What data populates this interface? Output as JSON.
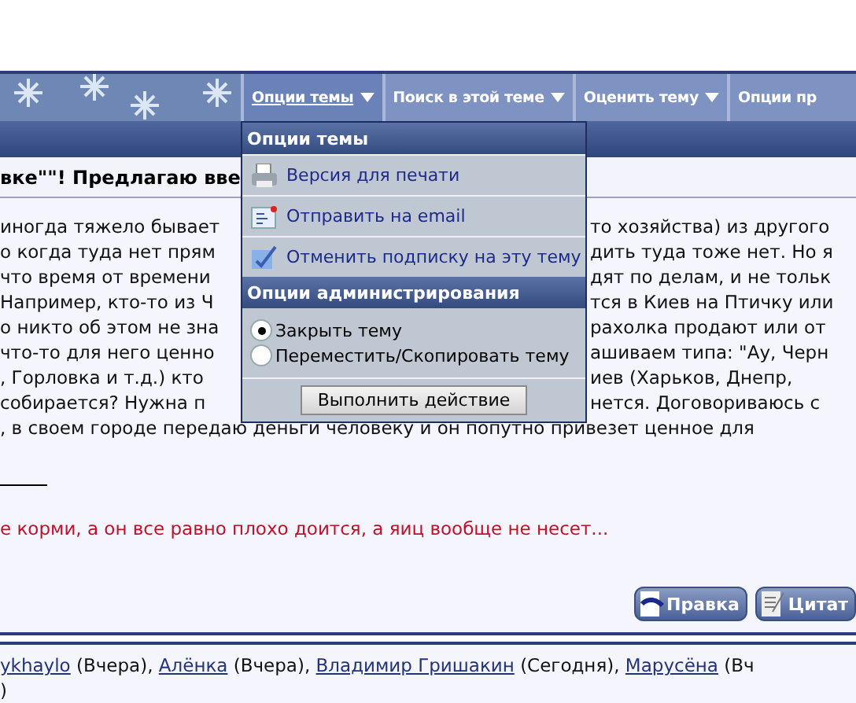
{
  "nav": {
    "tabs": [
      {
        "label": "Опции темы",
        "selected": true,
        "caret": true
      },
      {
        "label": "Поиск в этой теме",
        "selected": false,
        "caret": true
      },
      {
        "label": "Оценить тему",
        "selected": false,
        "caret": true
      },
      {
        "label": "Опции пр",
        "selected": false,
        "caret": false
      }
    ]
  },
  "thread_title": "вке\"\"! Предлагаю вве",
  "post": {
    "split_lines": [
      {
        "left": "иногда тяжело бывает",
        "right": "то хозяйства) из другого"
      },
      {
        "left": "о когда туда нет прям",
        "right": "дить туда тоже нет. Но я"
      },
      {
        "left": "что время от времени",
        "right": "дят по делам, и не тольк"
      },
      {
        "left": "Например, кто-то из Ч",
        "right": "тся в Киев на Птичку или"
      },
      {
        "left": "о никто об этом не зна",
        "right": "рахолка продают или от"
      },
      {
        "left": "что-то для него ценно",
        "right": "ашиваем типа: \"Ау, Черн"
      },
      {
        "left": ", Горловка и т.д.) кто",
        "right": "иев (Харьков, Днепр,"
      },
      {
        "left": " собирается? Нужна п",
        "right": "нется. Договориваюсь с"
      }
    ],
    "full_lines": [
      ", в своем городе передаю деньги человеку и он попутно привезет ценное для"
    ],
    "signature": "е корми, а он все равно плохо доится, а яиц вообще не несет...",
    "buttons": [
      {
        "label": "Правка",
        "kind": "edit"
      },
      {
        "label": "Цитат",
        "kind": "quote"
      }
    ]
  },
  "menu": {
    "title": "Опции темы",
    "items": [
      {
        "label": "Версия для печати",
        "kind": "print"
      },
      {
        "label": "Отправить на email",
        "kind": "email"
      },
      {
        "label": "Отменить подписку на эту тему",
        "kind": "unsubscribe"
      }
    ],
    "admin_title": "Опции администрирования",
    "options": [
      {
        "label": "Закрыть тему",
        "selected": true
      },
      {
        "label": "Переместить/Скопировать тему",
        "selected": false
      }
    ],
    "action_button": "Выполнить действие"
  },
  "visitors": {
    "entries": [
      {
        "name": "ykhaylo",
        "when": "(Вчера),"
      },
      {
        "name": "Алёнка",
        "when": "(Вчера),"
      },
      {
        "name": "Владимир Гришакин",
        "when": "(Сегодня),"
      },
      {
        "name": "Марусёна",
        "when": "(Вч"
      }
    ],
    "tail": ")"
  }
}
